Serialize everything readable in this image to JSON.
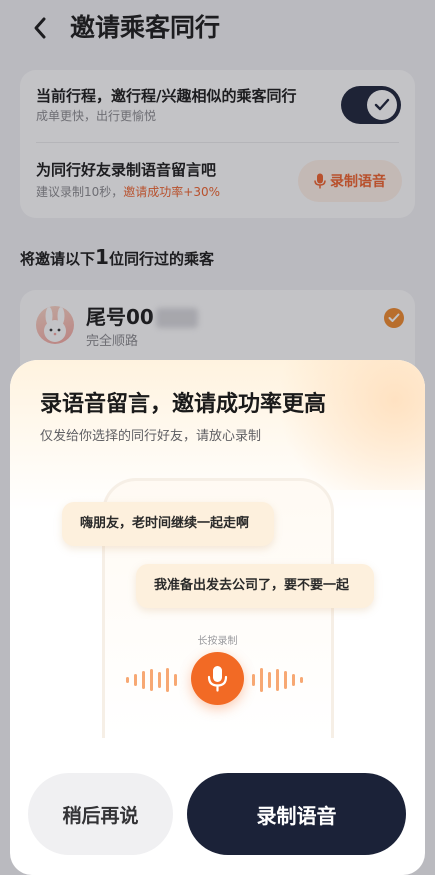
{
  "header": {
    "title": "邀请乘客同行"
  },
  "settings": {
    "row1_title": "当前行程，邀行程/兴趣相似的乘客同行",
    "row1_sub": "成单更快，出行更愉悦",
    "toggle_on": true,
    "row2_title": "为同行好友录制语音留言吧",
    "row2_sub_prefix": "建议录制10秒，",
    "row2_sub_highlight": "邀请成功率+30%",
    "record_button": "录制语音"
  },
  "section": {
    "prefix": "将邀请以下",
    "count": "1",
    "suffix": "位同行过的乘客"
  },
  "passenger": {
    "name": "尾号00",
    "sub": "完全顺路",
    "selected": true
  },
  "sheet": {
    "title": "录语音留言，邀请成功率更高",
    "subtitle": "仅发给你选择的同行好友，请放心录制",
    "bubble1": "嗨朋友，老时间继续一起走啊",
    "bubble2": "我准备出发去公司了，要不要一起",
    "hold_hint": "长按录制",
    "later_button": "稍后再说",
    "record_button": "录制语音"
  },
  "colors": {
    "accent": "#f0622c",
    "dark": "#1b2238",
    "mic": "#f26a25"
  }
}
